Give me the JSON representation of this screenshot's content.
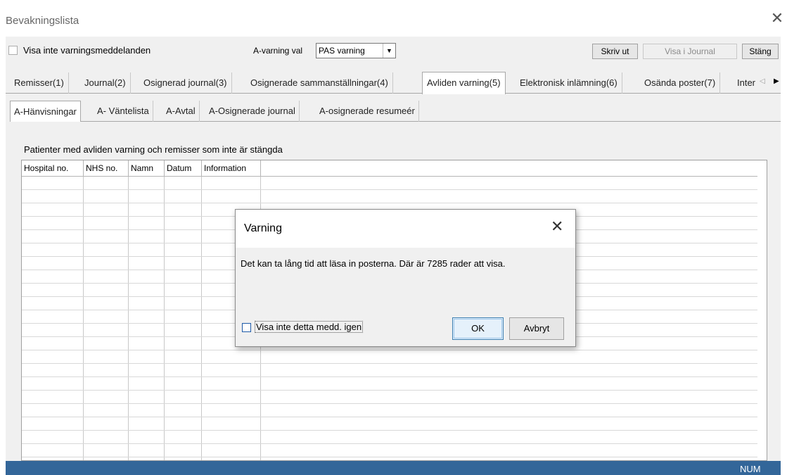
{
  "window": {
    "title": "Bevakningslista",
    "close_glyph": "✕"
  },
  "toolbar": {
    "hide_warnings_label": "Visa inte varningsmeddelanden",
    "a_varning_label": "A-varning val",
    "a_varning_value": "PAS varning",
    "print_label": "Skriv ut",
    "show_journal_label": "Visa i Journal",
    "close_label": "Stäng"
  },
  "tabs": [
    {
      "label": "Remisser(1)"
    },
    {
      "label": "Journal(2)"
    },
    {
      "label": "Osignerad journal(3)"
    },
    {
      "label": "Osignerade sammanställningar(4)"
    },
    {
      "label": "Avliden varning(5)"
    },
    {
      "label": "Elektronisk inlämning(6)"
    },
    {
      "label": "Osända poster(7)"
    },
    {
      "label": "Inter"
    }
  ],
  "subtabs": [
    {
      "label": "A-Hänvisningar"
    },
    {
      "label": "A- Väntelista"
    },
    {
      "label": "A-Avtal"
    },
    {
      "label": "A-Osignerade journal"
    },
    {
      "label": "A-osignerade resumeér"
    }
  ],
  "table": {
    "caption": "Patienter med avliden varning och remisser som inte är stängda",
    "columns": [
      "Hospital no.",
      "NHS no.",
      "Namn",
      "Datum",
      "Information"
    ]
  },
  "statusbar": {
    "num": "NUM"
  },
  "dialog": {
    "title": "Varning",
    "message": "Det kan ta lång tid att läsa in posterna. Där är 7285 rader att visa.",
    "checkbox_label": "Visa inte detta medd. igen",
    "ok_label": "OK",
    "cancel_label": "Avbryt"
  },
  "colors": {
    "statusbar": "#336699",
    "dialog_checkbox": "#1e5aa8"
  }
}
